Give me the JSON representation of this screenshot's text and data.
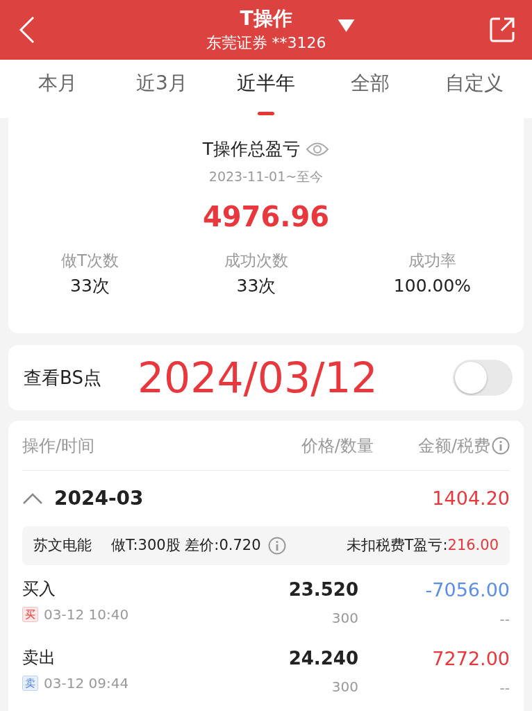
{
  "header": {
    "title": "T操作",
    "subtitle": "东莞证券 **3126"
  },
  "tabs": [
    {
      "label": "本月",
      "selected": false
    },
    {
      "label": "近3月",
      "selected": false
    },
    {
      "label": "近半年",
      "selected": true
    },
    {
      "label": "全部",
      "selected": false
    },
    {
      "label": "自定义",
      "selected": false
    }
  ],
  "summary": {
    "title": "T操作总盈亏",
    "period": "2023-11-01~至今",
    "total": "4976.96",
    "stats": [
      {
        "label": "做T次数",
        "value": "33次"
      },
      {
        "label": "成功次数",
        "value": "33次"
      },
      {
        "label": "成功率",
        "value": "100.00%"
      }
    ]
  },
  "bs_toggle": {
    "label": "查看BS点",
    "annotation": "2024/03/12",
    "on": false
  },
  "table": {
    "columns": [
      "操作/时间",
      "价格/数量",
      "金额/税费"
    ],
    "groups": [
      {
        "month": "2024-03",
        "total": "1404.20",
        "expanded": true,
        "stock": {
          "name": "苏文电能",
          "detail": "做T:300股 差价:0.720",
          "profit_label": "未扣税费T盈亏:",
          "profit": "216.00"
        },
        "trades": [
          {
            "kind": "buy",
            "action": "买入",
            "tag": "买",
            "time": "03-12 10:40",
            "price": "23.520",
            "qty": "300",
            "amount": "-7056.00",
            "fee": "--"
          },
          {
            "kind": "sell",
            "action": "卖出",
            "tag": "卖",
            "time": "03-12 09:44",
            "price": "24.240",
            "qty": "300",
            "amount": "7272.00",
            "fee": "--"
          }
        ]
      }
    ]
  }
}
